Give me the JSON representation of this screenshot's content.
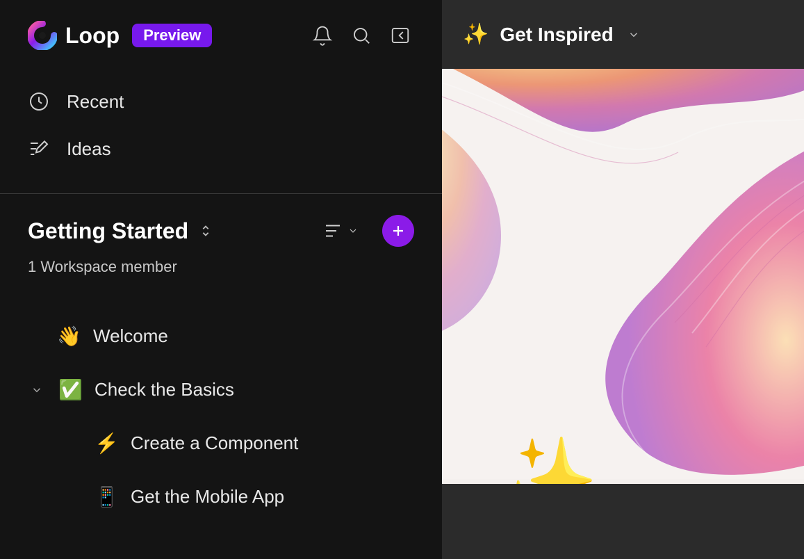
{
  "header": {
    "app_name": "Loop",
    "badge": "Preview"
  },
  "nav": {
    "recent": "Recent",
    "ideas": "Ideas"
  },
  "workspace": {
    "title": "Getting Started",
    "subtitle": "1 Workspace member"
  },
  "pages": [
    {
      "emoji": "👋",
      "label": "Welcome",
      "indent": 1,
      "expandable": false
    },
    {
      "emoji": "✅",
      "label": "Check the Basics",
      "indent": 1,
      "expandable": true,
      "expanded": true
    },
    {
      "emoji": "⚡",
      "label": "Create a Component",
      "indent": 2,
      "expandable": false
    },
    {
      "emoji": "📱",
      "label": "Get the Mobile App",
      "indent": 2,
      "expandable": false
    }
  ],
  "content": {
    "breadcrumb_emoji": "✨",
    "breadcrumb_title": "Get Inspired",
    "overlay_emoji": "✨"
  }
}
